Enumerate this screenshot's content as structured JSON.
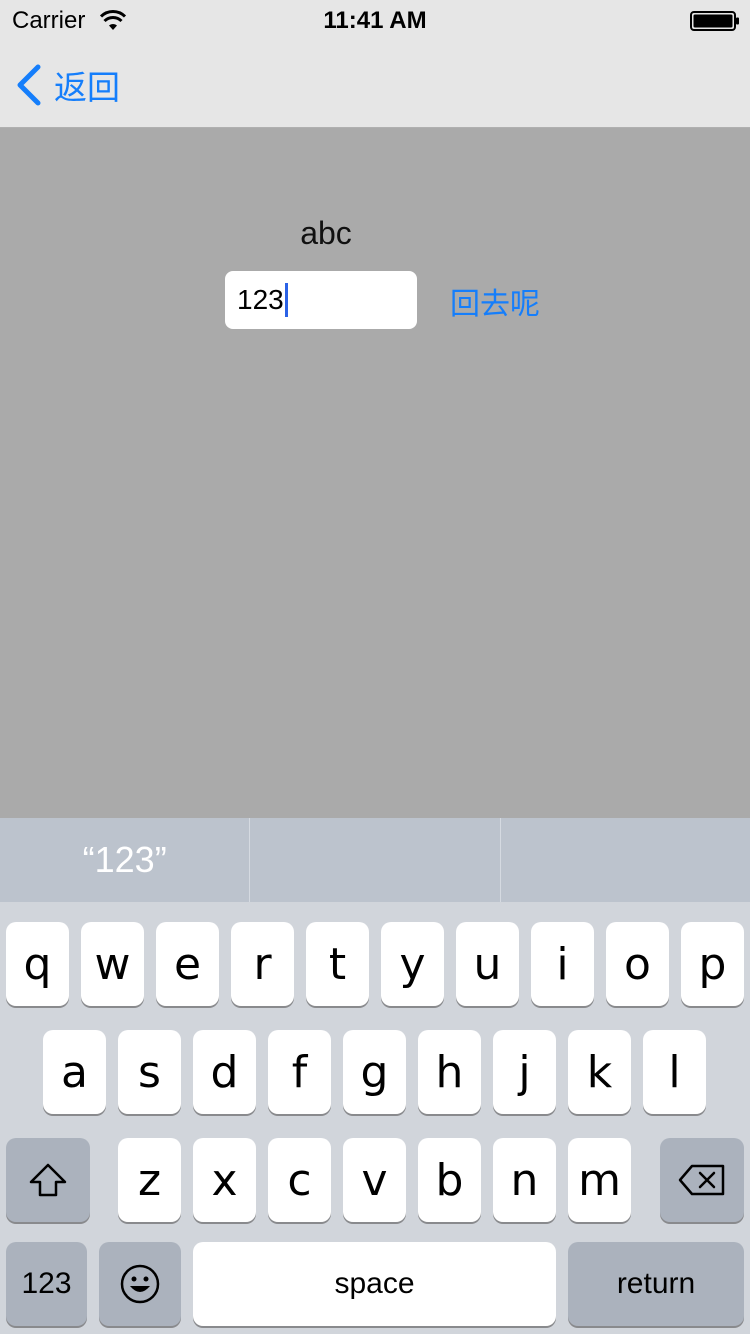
{
  "status_bar": {
    "carrier": "Carrier",
    "time": "11:41 AM",
    "wifi_icon": "wifi-icon",
    "battery_icon": "battery-icon"
  },
  "nav": {
    "back_label": "返回",
    "back_icon": "chevron-left-icon",
    "accent_color": "#157efb"
  },
  "content": {
    "label_text": "abc",
    "input_value": "123",
    "action_label": "回去呢",
    "background_color": "#aaaaaa"
  },
  "keyboard": {
    "suggestions": [
      "“123”",
      "",
      ""
    ],
    "row1": [
      "q",
      "w",
      "e",
      "r",
      "t",
      "y",
      "u",
      "i",
      "o",
      "p"
    ],
    "row2": [
      "a",
      "s",
      "d",
      "f",
      "g",
      "h",
      "j",
      "k",
      "l"
    ],
    "row3": [
      "z",
      "x",
      "c",
      "v",
      "b",
      "n",
      "m"
    ],
    "shift_icon": "shift-icon",
    "delete_icon": "delete-icon",
    "numbers_label": "123",
    "emoji_icon": "emoji-icon",
    "space_label": "space",
    "return_label": "return"
  }
}
